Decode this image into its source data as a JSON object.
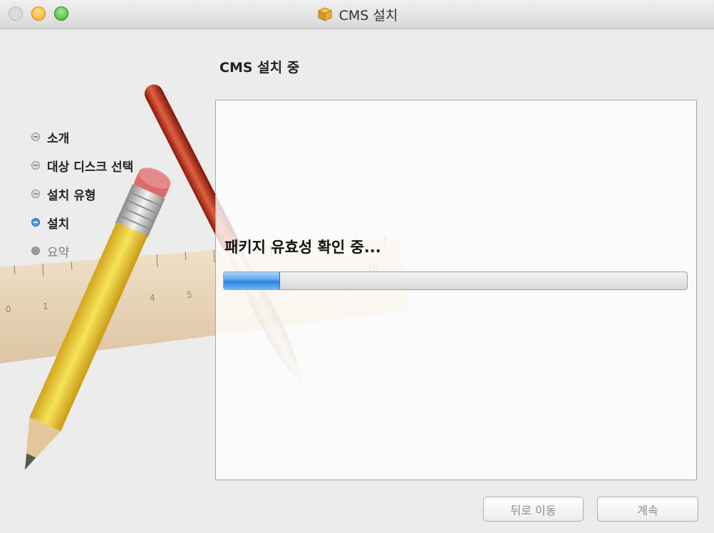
{
  "window": {
    "title": "CMS 설치"
  },
  "header": {
    "title": "CMS 설치 중"
  },
  "sidebar": {
    "steps": [
      {
        "label": "소개",
        "state": "done"
      },
      {
        "label": "대상 디스크 선택",
        "state": "done"
      },
      {
        "label": "설치 유형",
        "state": "done"
      },
      {
        "label": "설치",
        "state": "current"
      },
      {
        "label": "요약",
        "state": "pending"
      }
    ]
  },
  "panel": {
    "status_text": "패키지 유효성 확인 중...",
    "progress_fraction": 0.12
  },
  "buttons": {
    "back_label": "뒤로 이동",
    "continue_label": "계속"
  },
  "colors": {
    "accent": "#4b98e8",
    "progress_fill": "#3d8fe6"
  }
}
